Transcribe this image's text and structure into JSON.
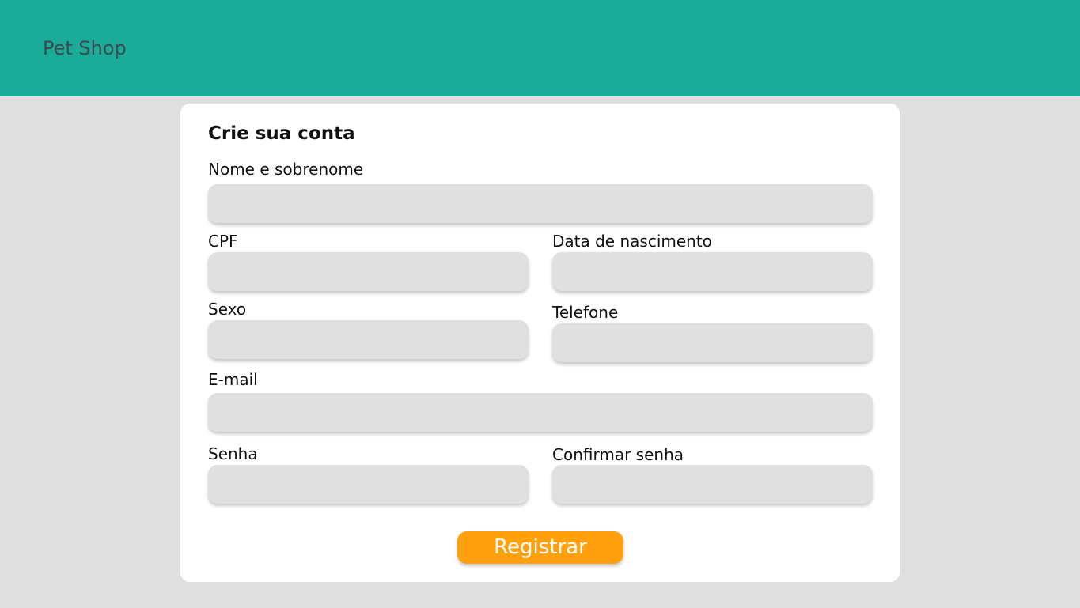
{
  "header": {
    "brand": "Pet Shop",
    "background_color": "#1aab99"
  },
  "form": {
    "title": "Crie sua conta",
    "fields": {
      "full_name": {
        "label": "Nome e sobrenome",
        "value": ""
      },
      "cpf": {
        "label": "CPF",
        "value": ""
      },
      "birth_date": {
        "label": "Data de nascimento",
        "value": ""
      },
      "sex": {
        "label": "Sexo",
        "value": ""
      },
      "phone": {
        "label": "Telefone",
        "value": ""
      },
      "email": {
        "label": "E-mail",
        "value": ""
      },
      "password": {
        "label": "Senha",
        "value": ""
      },
      "confirm_password": {
        "label": "Confirmar senha",
        "value": ""
      }
    },
    "submit_label": "Registrar",
    "submit_color": "#ffa10f"
  }
}
